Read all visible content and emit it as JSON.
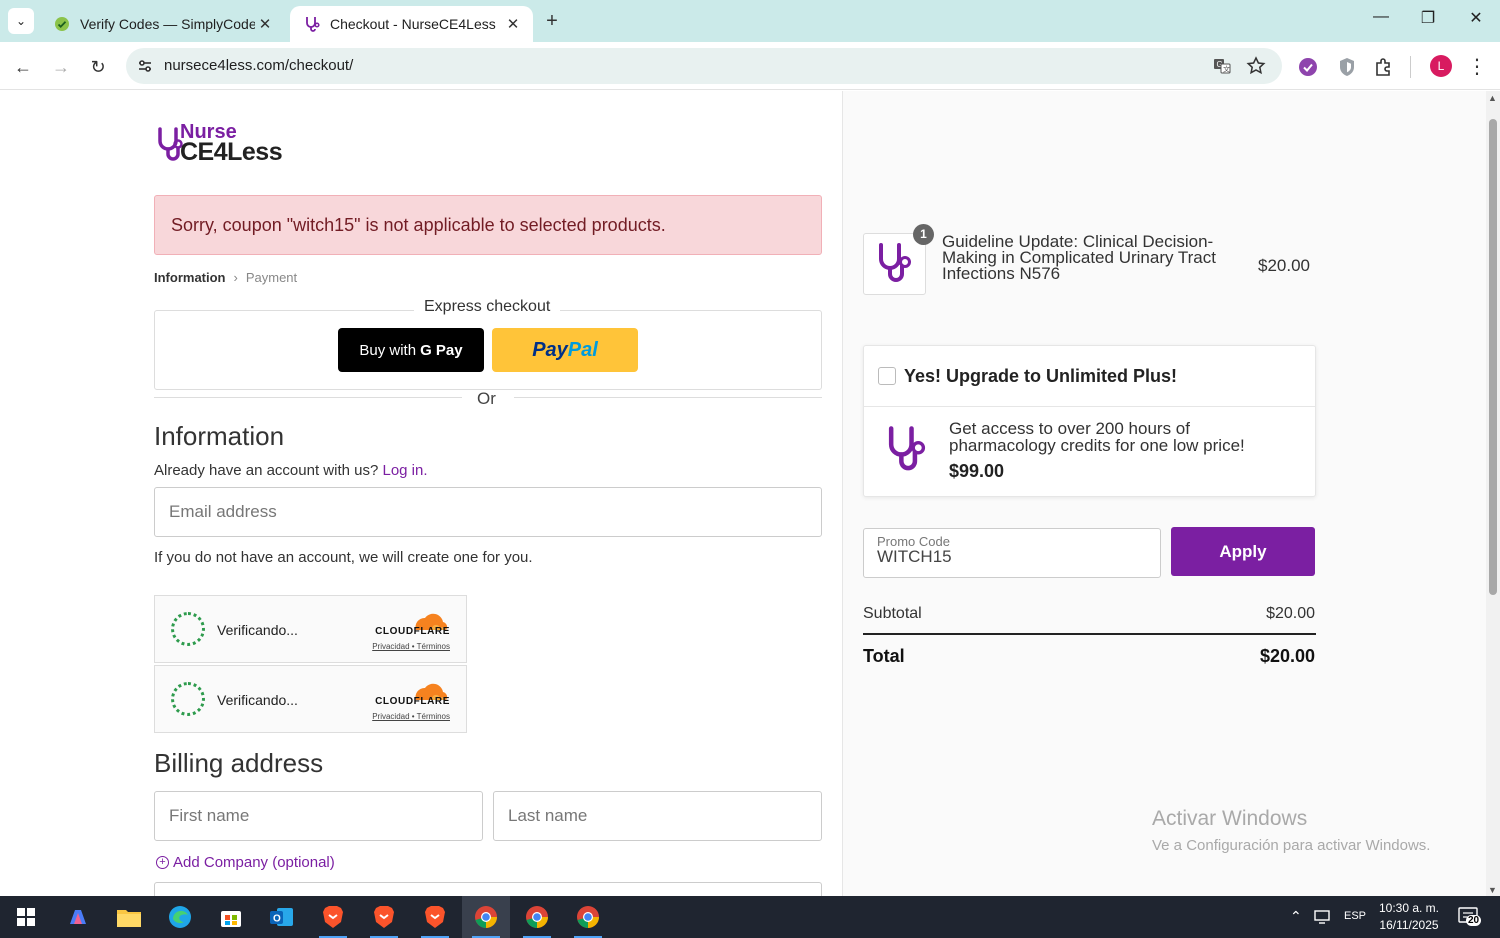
{
  "browser": {
    "tabs": [
      {
        "title": "Verify Codes — SimplyCodes",
        "active": false
      },
      {
        "title": "Checkout - NurseCE4Less",
        "active": true
      }
    ],
    "url": "nursece4less.com/checkout/",
    "profile_initial": "L"
  },
  "page": {
    "logo": {
      "line1": "Nurse",
      "line2": "CE4Less"
    },
    "alert": "Sorry, coupon \"witch15\" is not applicable to selected products.",
    "breadcrumb": {
      "step1": "Information",
      "step2": "Payment"
    },
    "express": {
      "title": "Express checkout",
      "gpay_text": "Buy with",
      "gpay_brand": "G Pay",
      "paypal_pay": "Pay",
      "paypal_pal": "Pal"
    },
    "or_text": "Or",
    "information": {
      "heading": "Information",
      "account_text": "Already have an account with us?",
      "login_link": "Log in.",
      "email_placeholder": "Email address",
      "create_note": "If you do not have an account, we will create one for you."
    },
    "captcha": [
      {
        "status": "Verificando...",
        "brand": "CLOUDFLARE",
        "links": "Privacidad • Términos"
      },
      {
        "status": "Verificando...",
        "brand": "CLOUDFLARE",
        "links": "Privacidad • Términos"
      }
    ],
    "billing": {
      "heading": "Billing address",
      "first_name_placeholder": "First name",
      "last_name_placeholder": "Last name",
      "add_company": "Add Company (optional)"
    }
  },
  "order": {
    "item": {
      "qty": "1",
      "name": "Guideline Update: Clinical Decision-Making in Complicated Urinary Tract Infections N576",
      "price": "$20.00"
    },
    "upsell": {
      "checkbox_label": "Yes! Upgrade to Unlimited Plus!",
      "checked": false,
      "description": "Get access to over 200 hours of pharmacology credits for one low price!",
      "price": "$99.00"
    },
    "promo": {
      "label": "Promo Code",
      "value": "WITCH15",
      "button": "Apply"
    },
    "subtotal_label": "Subtotal",
    "subtotal_value": "$20.00",
    "total_label": "Total",
    "total_value": "$20.00"
  },
  "watermark": {
    "line1": "Activar Windows",
    "line2": "Ve a Configuración para activar Windows."
  },
  "taskbar": {
    "lang": "ESP",
    "time": "10:30 a. m.",
    "date": "16/11/2025",
    "notifications": "20"
  },
  "colors": {
    "brand_purple": "#7b1fa2",
    "alert_bg": "#f8d7da",
    "paypal_yellow": "#ffc439"
  }
}
